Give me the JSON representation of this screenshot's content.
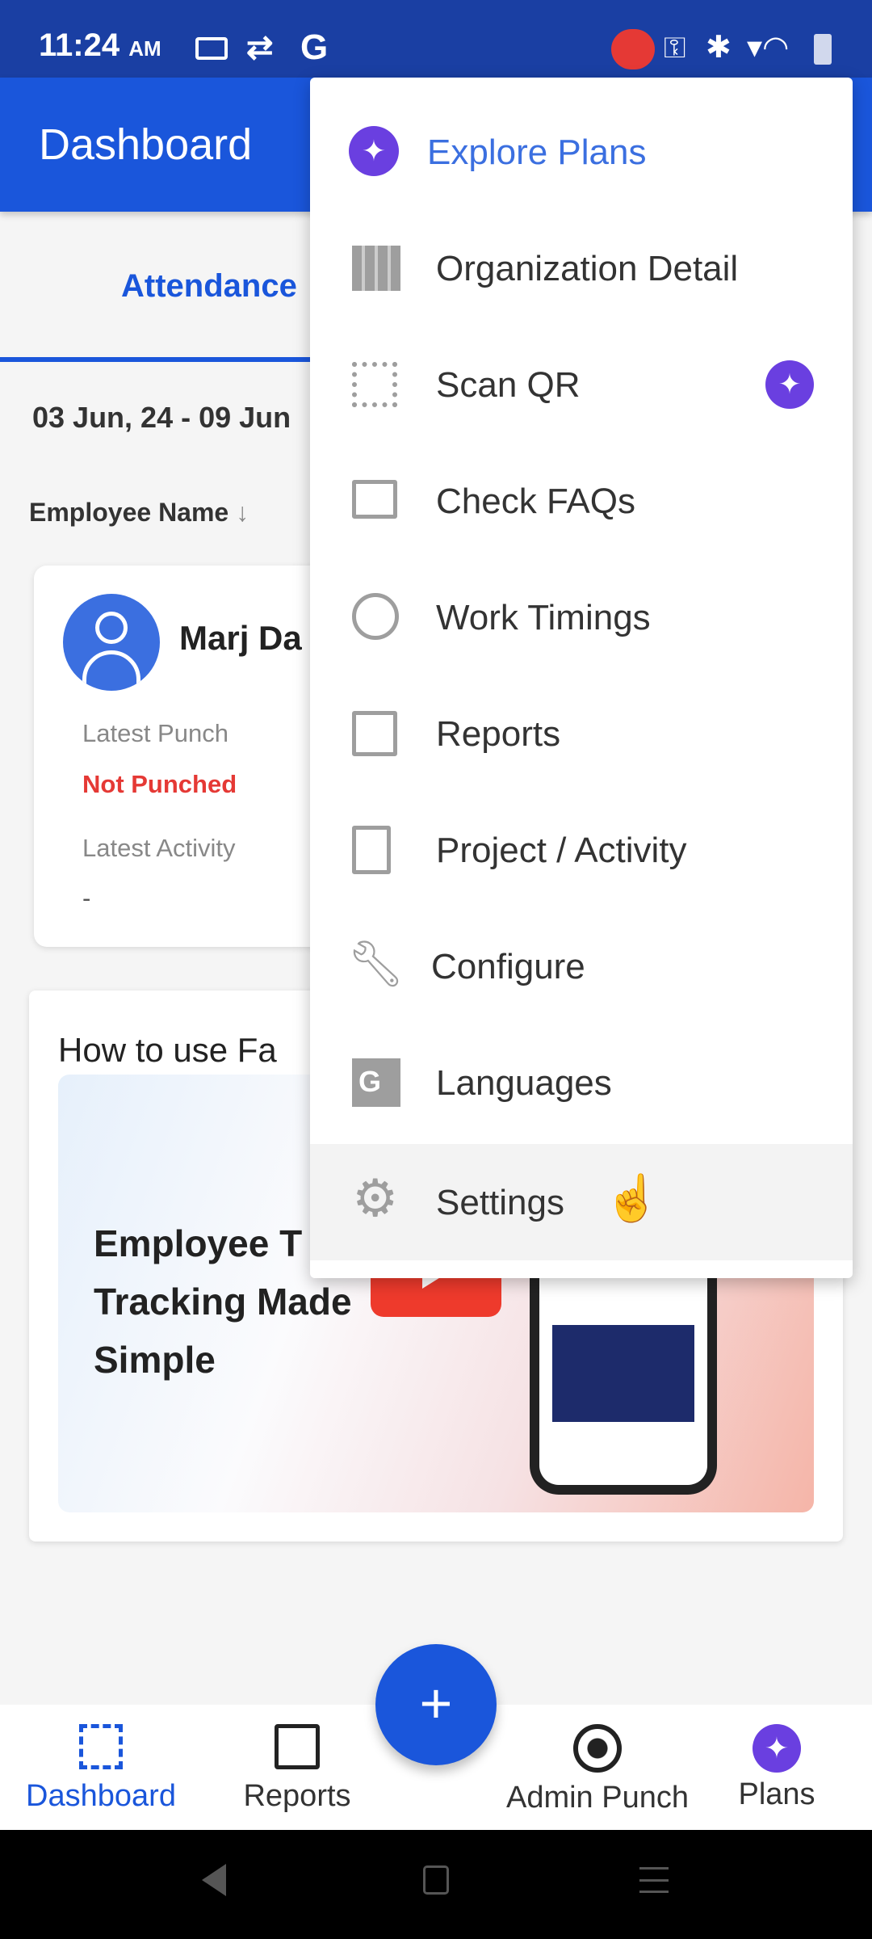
{
  "status_bar": {
    "time": "11:24",
    "ampm": "AM",
    "carrier_icon": "G"
  },
  "app_bar": {
    "title": "Dashboard"
  },
  "tabs": [
    {
      "label": "Attendance",
      "active": true
    }
  ],
  "date_range": "03 Jun, 24 - 09 Jun",
  "sort": {
    "label": "Employee Name",
    "icon": "arrow-down-icon"
  },
  "employee": {
    "name": "Marj Da",
    "latest_punch_label": "Latest Punch",
    "latest_punch_value": "Not Punched",
    "latest_activity_label": "Latest Activity",
    "latest_activity_value": "-"
  },
  "video_card": {
    "title": "How to use Fa",
    "thumb_lines": [
      "Employee T",
      "Tracking Made",
      "Simple"
    ]
  },
  "menu": {
    "items": [
      {
        "label": "Explore Plans",
        "icon": "sparkle-icon",
        "accent": true
      },
      {
        "label": "Organization Detail",
        "icon": "building-icon"
      },
      {
        "label": "Scan QR",
        "icon": "qr-code-icon",
        "badge": "sparkle-icon"
      },
      {
        "label": "Check FAQs",
        "icon": "chat-icon"
      },
      {
        "label": "Work Timings",
        "icon": "clock-icon"
      },
      {
        "label": "Reports",
        "icon": "bar-chart-icon"
      },
      {
        "label": "Project / Activity",
        "icon": "document-add-icon"
      },
      {
        "label": "Configure",
        "icon": "wrench-icon"
      },
      {
        "label": "Languages",
        "icon": "translate-icon"
      },
      {
        "label": "Settings",
        "icon": "gear-icon",
        "highlighted": true
      }
    ]
  },
  "bottom_nav": {
    "items": [
      {
        "label": "Dashboard",
        "icon": "dashboard-icon",
        "active": true
      },
      {
        "label": "Reports",
        "icon": "bar-chart-icon"
      },
      {
        "label": "Admin Punch",
        "icon": "target-icon"
      },
      {
        "label": "Plans",
        "icon": "sparkle-icon"
      }
    ],
    "fab": "+"
  },
  "colors": {
    "primary": "#1a56db",
    "accent": "#6a3fe0",
    "error": "#e53935"
  }
}
